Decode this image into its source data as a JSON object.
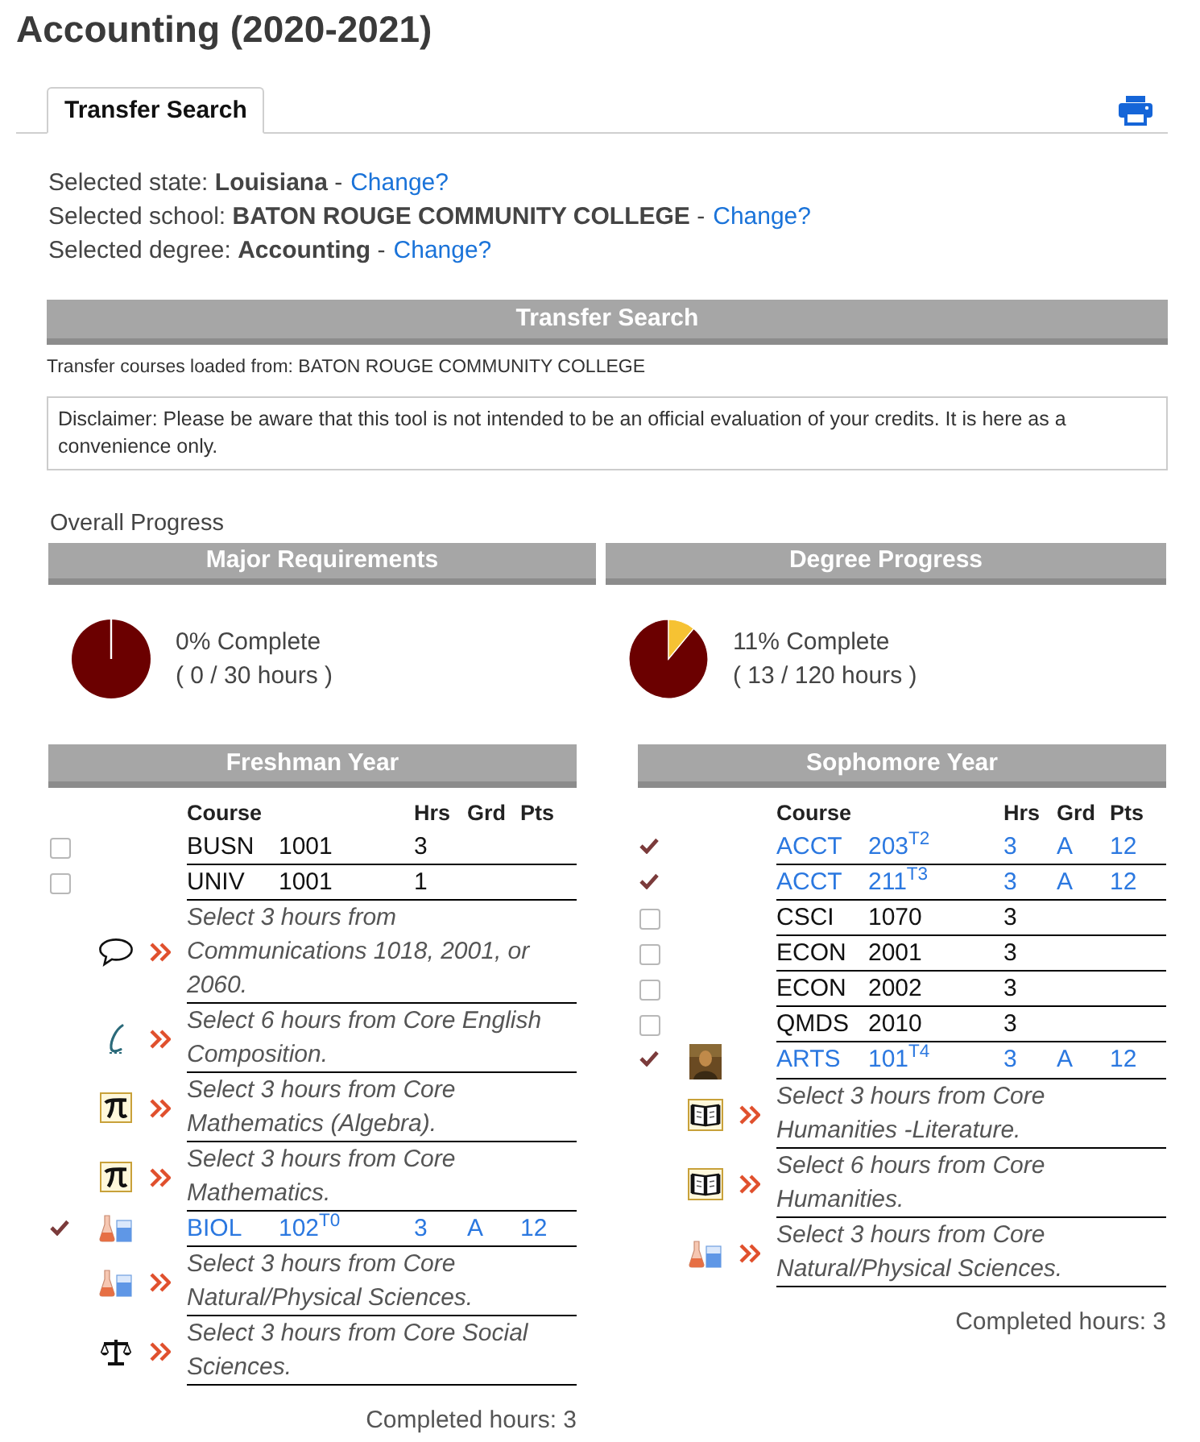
{
  "title": "Accounting (2020-2021)",
  "tabs": [
    {
      "label": "Transfer Search",
      "selected": true
    }
  ],
  "selections": [
    {
      "text": "Selected state: **Louisiana** -",
      "link": "Change?"
    },
    {
      "text": "Selected school: **BATON ROUGE COMMUNITY COLLEGE** -",
      "link": "Change?"
    },
    {
      "text": "Selected degree: **Accounting** -",
      "link": "Change?"
    }
  ],
  "transfer_section": {
    "title": "Transfer Search",
    "loaded_from": "Transfer courses loaded from: BATON ROUGE COMMUNITY COLLEGE",
    "disclaimer": "Disclaimer: Please be aware that this tool is not intended to be an official evaluation of your credits. It is here as a convenience only."
  },
  "overall_progress": {
    "heading": "Overall Progress",
    "panels": [
      {
        "title": "Major Requirements",
        "chart_data": {
          "type": "pie",
          "values": [
            0,
            100
          ]
        },
        "percent": "0% Complete",
        "hours": "( 0 / 30 hours )"
      },
      {
        "title": "Degree Progress",
        "chart_data": {
          "type": "pie",
          "values": [
            11,
            89
          ]
        },
        "percent": "11% Complete",
        "hours": "( 13 / 120 hours )"
      }
    ]
  },
  "years": [
    {
      "title": "Freshman Year",
      "columns": [
        "Course",
        "Hrs",
        "Grd",
        "Pts"
      ],
      "rows": [
        {
          "kind": "course",
          "checked": false,
          "subject": "BUSN",
          "number": "1001",
          "hours": "3"
        },
        {
          "kind": "course",
          "checked": false,
          "subject": "UNIV",
          "number": "1001",
          "hours": "1"
        },
        {
          "kind": "requirement",
          "icon": {
            "kind": "speech-bubble"
          },
          "text": "Select 3 hours from Communications 1018, 2001, or 2060."
        },
        {
          "kind": "requirement",
          "icon": {
            "kind": "pen"
          },
          "text": "Select 6 hours from Core English Composition."
        },
        {
          "kind": "requirement",
          "icon": {
            "kind": "pi"
          },
          "text": "Select 3 hours from Core Mathematics (Algebra)."
        },
        {
          "kind": "requirement",
          "icon": {
            "kind": "pi"
          },
          "text": "Select 3 hours from Core Mathematics."
        },
        {
          "kind": "course",
          "checked": true,
          "icon": {
            "kind": "flasks"
          },
          "subject": "BIOL",
          "number": "102$^{T0}$",
          "hours": "3",
          "grade": "A",
          "points": "12"
        },
        {
          "kind": "requirement",
          "icon": {
            "kind": "flasks"
          },
          "text": "Select 3 hours from Core Natural/Physical Sciences."
        },
        {
          "kind": "requirement",
          "icon": {
            "kind": "scales"
          },
          "text": "Select 3 hours from Core Social Sciences."
        }
      ],
      "completed": "Completed hours: 3"
    },
    {
      "title": "Sophomore Year",
      "columns": [
        "Course",
        "Hrs",
        "Grd",
        "Pts"
      ],
      "rows": [
        {
          "kind": "course",
          "checked": true,
          "subject": "ACCT",
          "number": "203$^{T2}$",
          "hours": "3",
          "grade": "A",
          "points": "12"
        },
        {
          "kind": "course",
          "checked": true,
          "subject": "ACCT",
          "number": "211$^{T3}$",
          "hours": "3",
          "grade": "A",
          "points": "12"
        },
        {
          "kind": "course",
          "checked": false,
          "subject": "CSCI",
          "number": "1070",
          "hours": "3"
        },
        {
          "kind": "course",
          "checked": false,
          "subject": "ECON",
          "number": "2001",
          "hours": "3"
        },
        {
          "kind": "course",
          "checked": false,
          "subject": "ECON",
          "number": "2002",
          "hours": "3"
        },
        {
          "kind": "course",
          "checked": false,
          "subject": "QMDS",
          "number": "2010",
          "hours": "3"
        },
        {
          "kind": "course",
          "checked": true,
          "icon": {
            "kind": "painting"
          },
          "subject": "ARTS",
          "number": "101$^{T4}$",
          "hours": "3",
          "grade": "A",
          "points": "12"
        },
        {
          "kind": "requirement",
          "icon": {
            "kind": "book"
          },
          "text": "Select 3 hours from Core Humanities -Literature."
        },
        {
          "kind": "requirement",
          "icon": {
            "kind": "book"
          },
          "text": "Select 6 hours from Core Humanities."
        },
        {
          "kind": "requirement",
          "icon": {
            "kind": "flasks"
          },
          "text": "Select 3 hours from Core Natural/Physical Sciences."
        }
      ],
      "completed": "Completed hours: 3"
    }
  ]
}
